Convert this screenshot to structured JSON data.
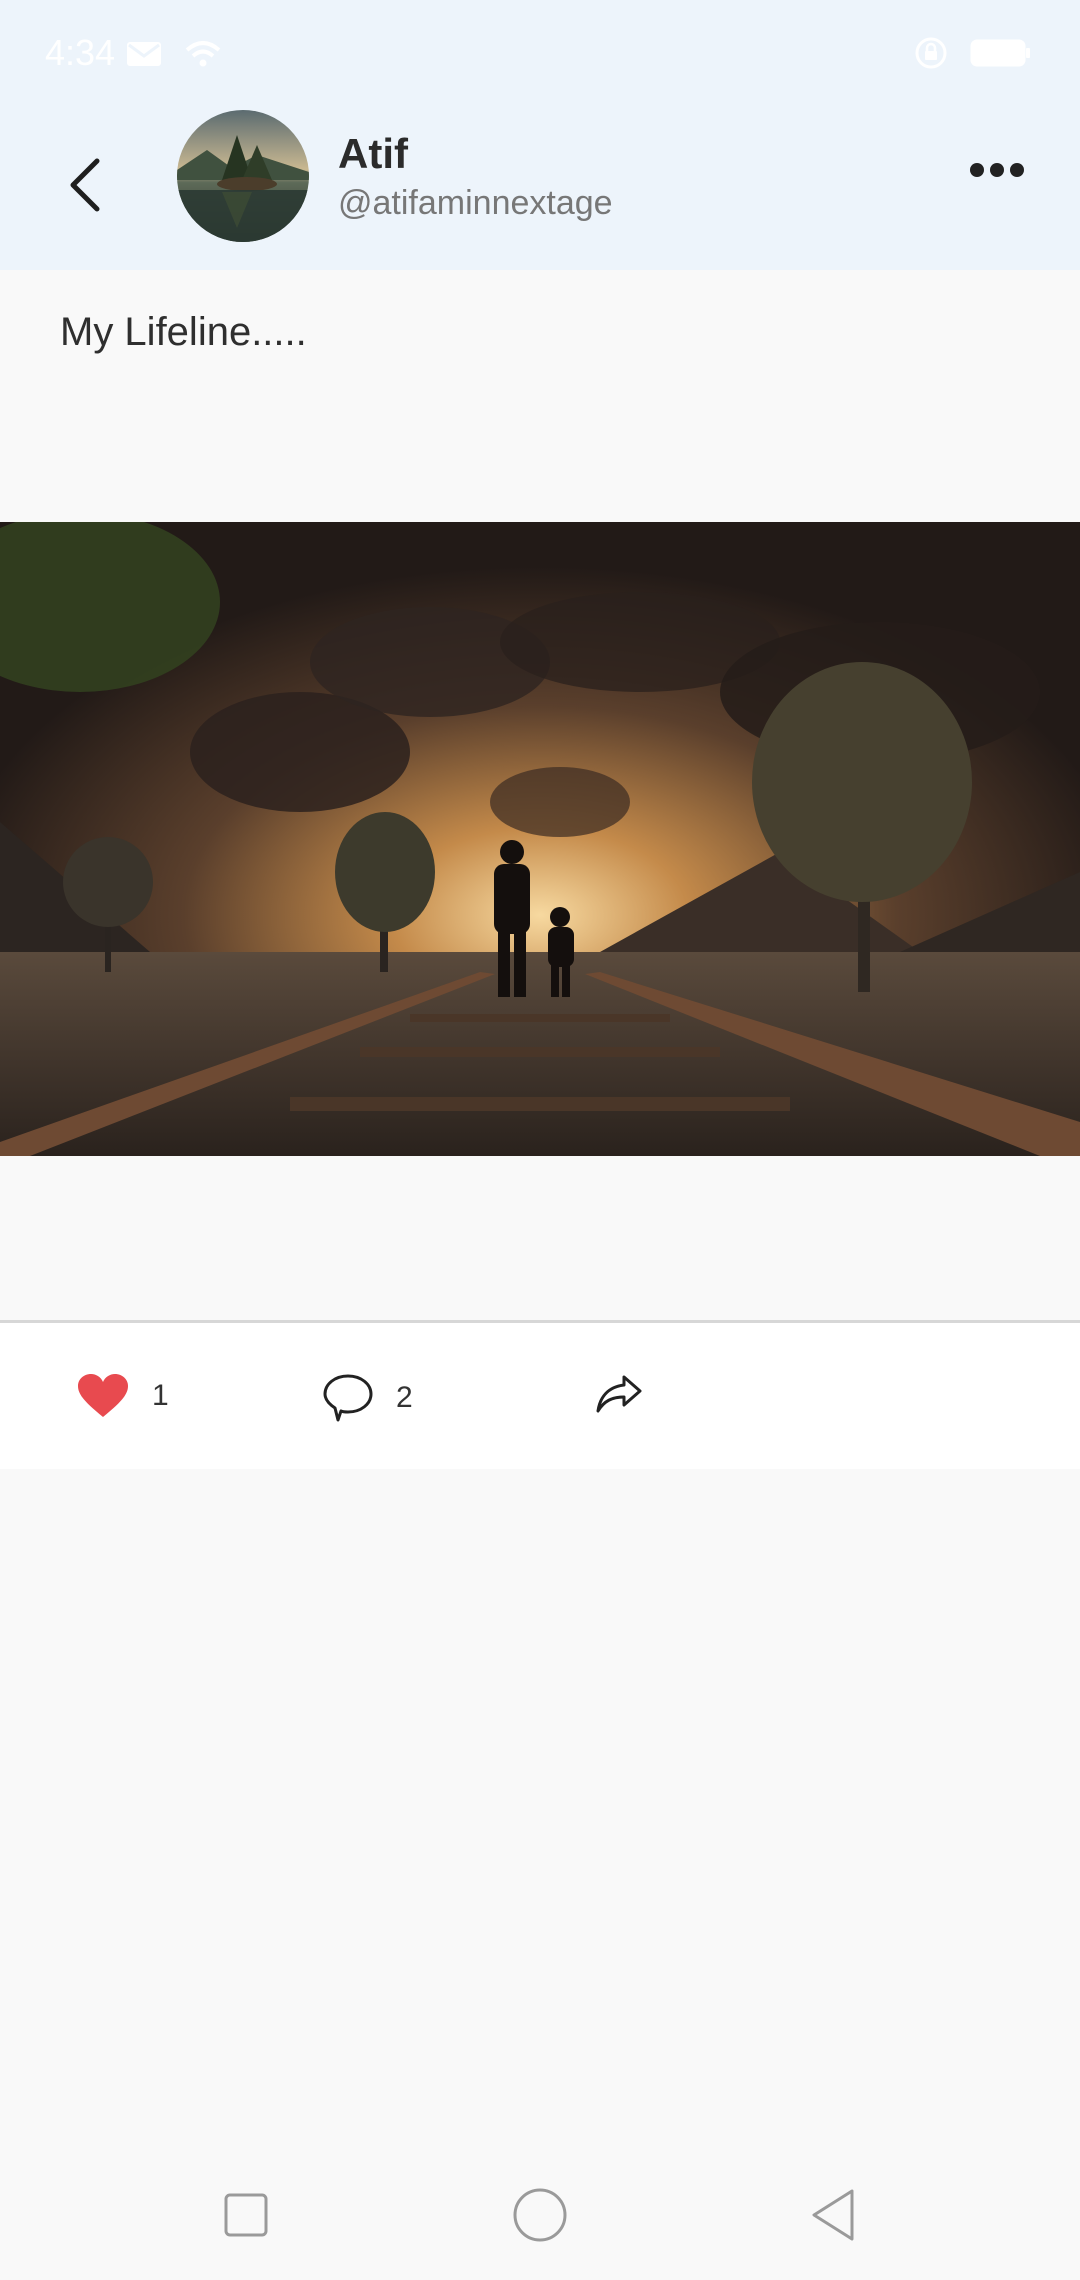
{
  "status": {
    "time": "4:34"
  },
  "header": {
    "name": "Atif",
    "handle": "@atifaminnextage"
  },
  "post": {
    "text": "My Lifeline.....",
    "likes": "1",
    "comments": "2"
  },
  "colors": {
    "header_bg": "#edf4fb",
    "like": "#e84a4f",
    "text": "#2f2f2f"
  },
  "icons": [
    "back-arrow-icon",
    "more-dots-icon",
    "heart-icon",
    "comment-icon",
    "share-icon",
    "square-nav-icon",
    "circle-nav-icon",
    "triangle-nav-icon"
  ]
}
